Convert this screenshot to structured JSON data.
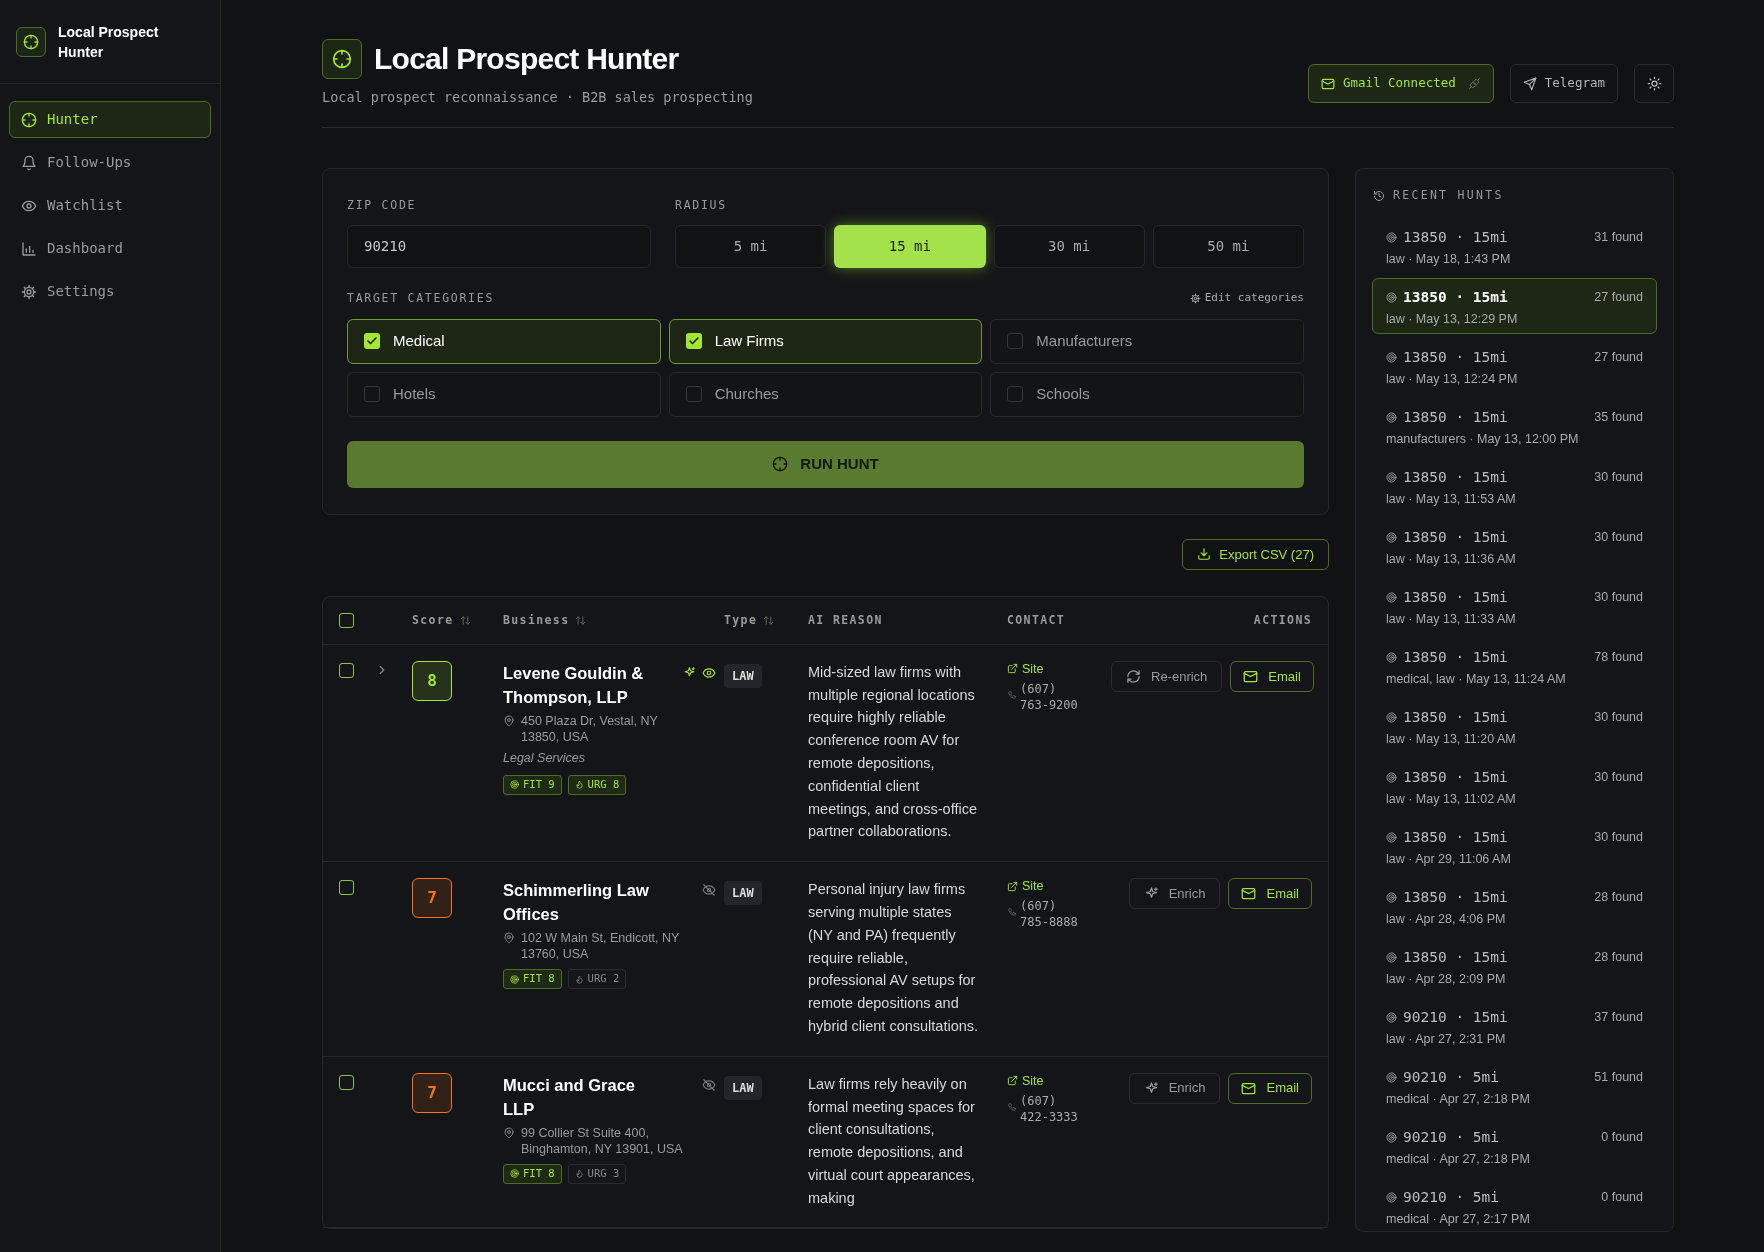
{
  "sidebar": {
    "app_name": "Local Prospect Hunter",
    "nav": [
      {
        "label": "Hunter",
        "selected": true
      },
      {
        "label": "Follow-Ups",
        "selected": false
      },
      {
        "label": "Watchlist",
        "selected": false
      },
      {
        "label": "Dashboard",
        "selected": false
      },
      {
        "label": "Settings",
        "selected": false
      }
    ]
  },
  "header": {
    "title": "Local Prospect Hunter",
    "subtitle": "Local prospect reconnaissance · B2B sales prospecting",
    "gmail": {
      "label": "Gmail Connected",
      "connected": true
    },
    "telegram": {
      "label": "Telegram"
    }
  },
  "form": {
    "zip_label": "ZIP CODE",
    "zip_value": "90210",
    "radius_label": "RADIUS",
    "radius_options": [
      {
        "label": "5 mi",
        "selected": false
      },
      {
        "label": "15 mi",
        "selected": true
      },
      {
        "label": "30 mi",
        "selected": false
      },
      {
        "label": "50 mi",
        "selected": false
      }
    ],
    "categories_label": "TARGET CATEGORIES",
    "edit_link": "Edit categories",
    "categories": [
      {
        "label": "Medical",
        "checked": true
      },
      {
        "label": "Law Firms",
        "checked": true
      },
      {
        "label": "Manufacturers",
        "checked": false
      },
      {
        "label": "Hotels",
        "checked": false
      },
      {
        "label": "Churches",
        "checked": false
      },
      {
        "label": "Schools",
        "checked": false
      }
    ],
    "run_button": "RUN HUNT"
  },
  "export_button": "Export CSV (27)",
  "table": {
    "all_checked": false,
    "columns": [
      {
        "label": "Score",
        "sortable": true
      },
      {
        "label": "Business",
        "sortable": true
      },
      {
        "label": "Type",
        "sortable": true
      },
      {
        "label": "AI REASON",
        "sortable": false
      },
      {
        "label": "CONTACT",
        "sortable": false
      },
      {
        "label": "ACTIONS",
        "sortable": false
      }
    ],
    "rows": [
      {
        "checked": false,
        "expandable": true,
        "score": "8",
        "color": "#a3e635",
        "name": "Levene Gouldin & Thompson, LLP",
        "enriched": true,
        "watching": true,
        "address": "450 Plaza Dr, Vestal, NY 13850, USA",
        "category": "Legal Services",
        "fit": {
          "label": "FIT 9",
          "highlighted": true
        },
        "urg": {
          "label": "URG 8",
          "highlighted": true
        },
        "type": "LAW",
        "reason": "Mid-sized law firms with multiple regional locations require highly reliable conference room AV for remote depositions, confidential client meetings, and cross-office partner collaborations.",
        "site": "Site",
        "phone": "(607) 763-9200",
        "enrich_button": "Re-enrich",
        "email_button": "Email"
      },
      {
        "checked": false,
        "expandable": false,
        "score": "7",
        "color": "#f97316",
        "name": "Schimmerling Law Offices",
        "enriched": false,
        "watching": false,
        "address": "102 W Main St, Endicott, NY 13760, USA",
        "fit": {
          "label": "FIT 8",
          "highlighted": true
        },
        "urg": {
          "label": "URG 2",
          "highlighted": false
        },
        "type": "LAW",
        "reason": "Personal injury law firms serving multiple states (NY and PA) frequently require reliable, professional AV setups for remote depositions and hybrid client consultations.",
        "site": "Site",
        "phone": "(607) 785-8888",
        "enrich_button": "Enrich",
        "email_button": "Email"
      },
      {
        "checked": false,
        "expandable": false,
        "score": "7",
        "color": "#f97316",
        "name": "Mucci and Grace LLP",
        "enriched": false,
        "watching": false,
        "address": "99 Collier St Suite 400, Binghamton, NY 13901, USA",
        "fit": {
          "label": "FIT 8",
          "highlighted": true
        },
        "urg": {
          "label": "URG 3",
          "highlighted": false
        },
        "type": "LAW",
        "reason": "Law firms rely heavily on formal meeting spaces for client consultations, remote depositions, and virtual court appearances, making",
        "site": "Site",
        "phone": "(607) 422-3333",
        "enrich_button": "Enrich",
        "email_button": "Email"
      }
    ]
  },
  "recent_hunts": {
    "title": "RECENT HUNTS",
    "items": [
      {
        "title": "13850 · 15mi",
        "found": "31 found",
        "meta": "law · May 18, 1:43 PM",
        "selected": false
      },
      {
        "title": "13850 · 15mi",
        "found": "27 found",
        "meta": "law · May 13, 12:29 PM",
        "selected": true
      },
      {
        "title": "13850 · 15mi",
        "found": "27 found",
        "meta": "law · May 13, 12:24 PM",
        "selected": false
      },
      {
        "title": "13850 · 15mi",
        "found": "35 found",
        "meta": "manufacturers · May 13, 12:00 PM",
        "selected": false
      },
      {
        "title": "13850 · 15mi",
        "found": "30 found",
        "meta": "law · May 13, 11:53 AM",
        "selected": false
      },
      {
        "title": "13850 · 15mi",
        "found": "30 found",
        "meta": "law · May 13, 11:36 AM",
        "selected": false
      },
      {
        "title": "13850 · 15mi",
        "found": "30 found",
        "meta": "law · May 13, 11:33 AM",
        "selected": false
      },
      {
        "title": "13850 · 15mi",
        "found": "78 found",
        "meta": "medical, law · May 13, 11:24 AM",
        "selected": false
      },
      {
        "title": "13850 · 15mi",
        "found": "30 found",
        "meta": "law · May 13, 11:20 AM",
        "selected": false
      },
      {
        "title": "13850 · 15mi",
        "found": "30 found",
        "meta": "law · May 13, 11:02 AM",
        "selected": false
      },
      {
        "title": "13850 · 15mi",
        "found": "30 found",
        "meta": "law · Apr 29, 11:06 AM",
        "selected": false
      },
      {
        "title": "13850 · 15mi",
        "found": "28 found",
        "meta": "law · Apr 28, 4:06 PM",
        "selected": false
      },
      {
        "title": "13850 · 15mi",
        "found": "28 found",
        "meta": "law · Apr 28, 2:09 PM",
        "selected": false
      },
      {
        "title": "90210 · 15mi",
        "found": "37 found",
        "meta": "law · Apr 27, 2:31 PM",
        "selected": false
      },
      {
        "title": "90210 · 5mi",
        "found": "51 found",
        "meta": "medical · Apr 27, 2:18 PM",
        "selected": false
      },
      {
        "title": "90210 · 5mi",
        "found": "0 found",
        "meta": "medical · Apr 27, 2:18 PM",
        "selected": false
      },
      {
        "title": "90210 · 5mi",
        "found": "0 found",
        "meta": "medical · Apr 27, 2:17 PM",
        "selected": false
      }
    ]
  }
}
